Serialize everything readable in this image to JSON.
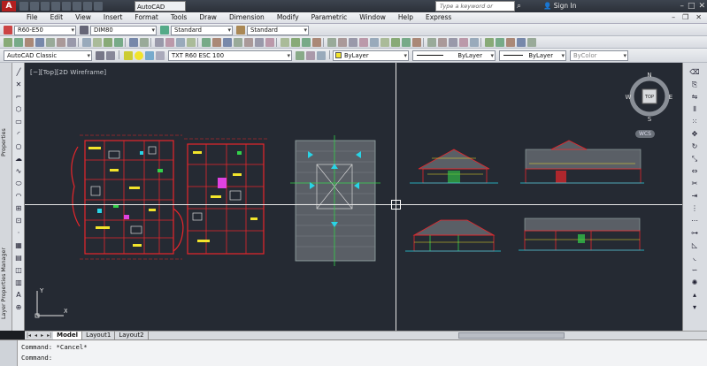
{
  "titlebar": {
    "workspace": "AutoCAD Classic",
    "search_placeholder": "Type a keyword or phrase",
    "signin": "Sign In"
  },
  "menu": [
    "File",
    "Edit",
    "View",
    "Insert",
    "Format",
    "Tools",
    "Draw",
    "Dimension",
    "Modify",
    "Parametric",
    "Window",
    "Help",
    "Express"
  ],
  "toolbar1": {
    "text_style": "R60-E50",
    "dim_style": "DIM80",
    "table_style": "Standard",
    "multileader_style": "Standard"
  },
  "toolbar3": {
    "workspace": "AutoCAD Classic",
    "layer": "TXT R60 ESC 100",
    "color": "ByLayer",
    "linetype": "ByLayer",
    "lineweight": "ByLayer",
    "plotstyle": "ByColor"
  },
  "viewport": {
    "label": "[−][Top][2D Wireframe]",
    "wcs": "WCS",
    "ucs_x": "X",
    "ucs_y": "Y"
  },
  "viewcube": {
    "north": "N",
    "south": "S",
    "east": "E",
    "west": "W",
    "face": "TOP"
  },
  "palettes": {
    "properties": "Properties",
    "layer_manager": "Layer Properties Manager"
  },
  "tabs": [
    "Model",
    "Layout1",
    "Layout2"
  ],
  "command": {
    "line1": "Command: *Cancel*",
    "line2": "Command:"
  },
  "colors": {
    "canvas": "#252a33",
    "red": "#e8262b",
    "yellow": "#f2e42b",
    "green": "#33d14a",
    "cyan": "#29d4e6",
    "magenta": "#e042e0",
    "blue": "#3a64ff"
  }
}
